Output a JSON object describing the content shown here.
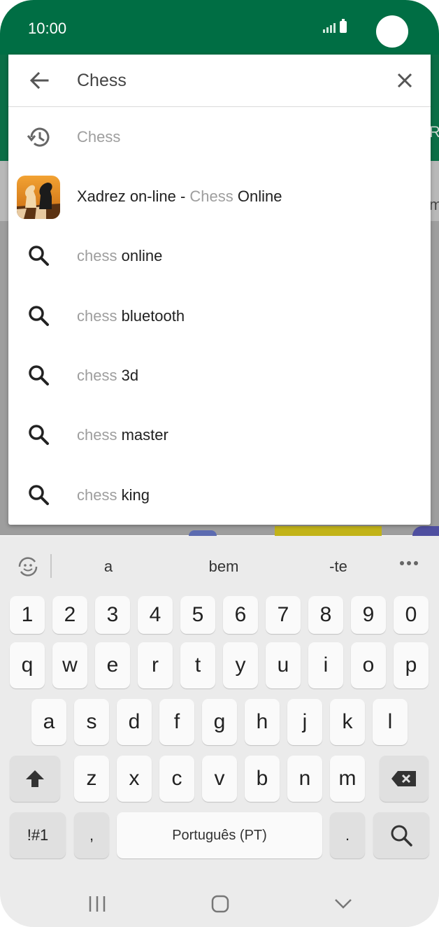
{
  "status_bar": {
    "time": "10:00"
  },
  "search": {
    "query": "Chess",
    "back_icon": "arrow-left-icon",
    "clear_icon": "close-icon"
  },
  "suggestions": [
    {
      "type": "history",
      "icon": "history-icon",
      "dim": "Chess",
      "rest": ""
    },
    {
      "type": "app",
      "icon": "chess-app-icon",
      "prefix": "Xadrez on-line - ",
      "dim": "Chess",
      "rest": " Online"
    },
    {
      "type": "query",
      "icon": "search-icon",
      "dim": "chess",
      "rest": " online"
    },
    {
      "type": "query",
      "icon": "search-icon",
      "dim": "chess",
      "rest": " bluetooth"
    },
    {
      "type": "query",
      "icon": "search-icon",
      "dim": "chess",
      "rest": " 3d"
    },
    {
      "type": "query",
      "icon": "search-icon",
      "dim": "chess",
      "rest": " master"
    },
    {
      "type": "query",
      "icon": "search-icon",
      "dim": "chess",
      "rest": " king"
    }
  ],
  "keyboard": {
    "predictions": [
      "a",
      "bem",
      "-te"
    ],
    "row_numbers": [
      "1",
      "2",
      "3",
      "4",
      "5",
      "6",
      "7",
      "8",
      "9",
      "0"
    ],
    "row_1": [
      "q",
      "w",
      "e",
      "r",
      "t",
      "y",
      "u",
      "i",
      "o",
      "p"
    ],
    "row_2": [
      "a",
      "s",
      "d",
      "f",
      "g",
      "h",
      "j",
      "k",
      "l"
    ],
    "row_3": [
      "z",
      "x",
      "c",
      "v",
      "b",
      "n",
      "m"
    ],
    "symbols_label": "!#1",
    "comma_label": ",",
    "space_label": "Português (PT)",
    "period_label": ".",
    "shift_icon": "shift-icon",
    "backspace_icon": "backspace-icon",
    "search_key_icon": "search-icon"
  },
  "peek_text": {
    "r": "R",
    "m": "m"
  },
  "colors": {
    "brand_green": "#006e44",
    "dim_text": "#9e9e9e"
  }
}
